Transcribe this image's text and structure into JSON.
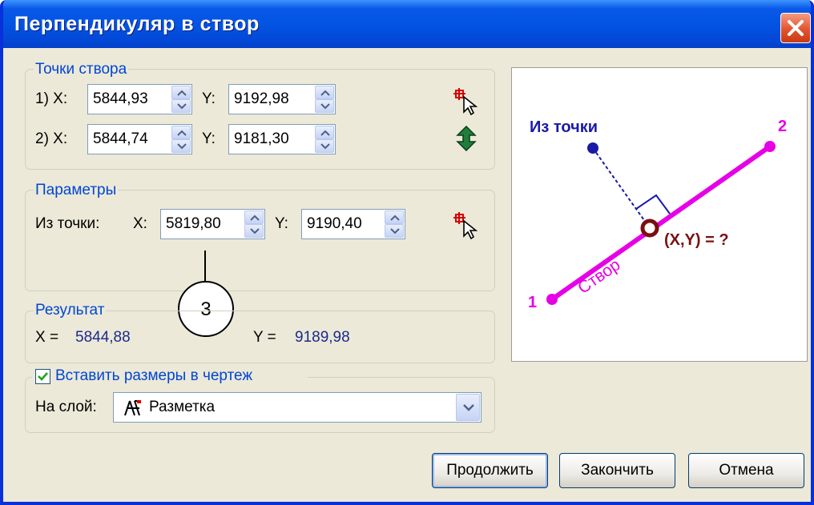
{
  "window": {
    "title": "Перпендикуляр в створ"
  },
  "stvor": {
    "legend": "Точки створа",
    "p1": {
      "label": "1) X:",
      "x": "5844,93",
      "y_label": "Y:",
      "y": "9192,98"
    },
    "p2": {
      "label": "2) X:",
      "x": "5844,74",
      "y_label": "Y:",
      "y": "9181,30"
    }
  },
  "params": {
    "legend": "Параметры",
    "from_label": "Из точки:",
    "x_label": "X:",
    "x": "5819,80",
    "y_label": "Y:",
    "y": "9190,40"
  },
  "result": {
    "legend": "Результат",
    "x_label": "X =",
    "x": "5844,88",
    "y_label": "Y =",
    "y": "9189,98"
  },
  "insert": {
    "checkbox_label": "Вставить размеры в чертеж",
    "checked": true,
    "layer_label": "На слой:",
    "layer_value": "Разметка"
  },
  "diagram": {
    "from_point": "Из точки",
    "point1": "1",
    "point2": "2",
    "result": "(X,Y) = ?",
    "line_label": "Створ"
  },
  "callout": "3",
  "buttons": {
    "continue": "Продолжить",
    "finish": "Закончить",
    "cancel": "Отмена"
  },
  "icons": [
    "close-icon",
    "pick-point-icon",
    "swap-points-icon",
    "spin-up-icon",
    "spin-down-icon",
    "layer-icon",
    "dropdown-arrow-icon",
    "checkmark-icon"
  ],
  "colors": {
    "title_bar": "#0354e2",
    "group_legend": "#0046d5",
    "result_value": "#1b2b8c",
    "line": "#e600e6",
    "from_point": "#1a1aa6",
    "result_point": "#7a1010"
  }
}
